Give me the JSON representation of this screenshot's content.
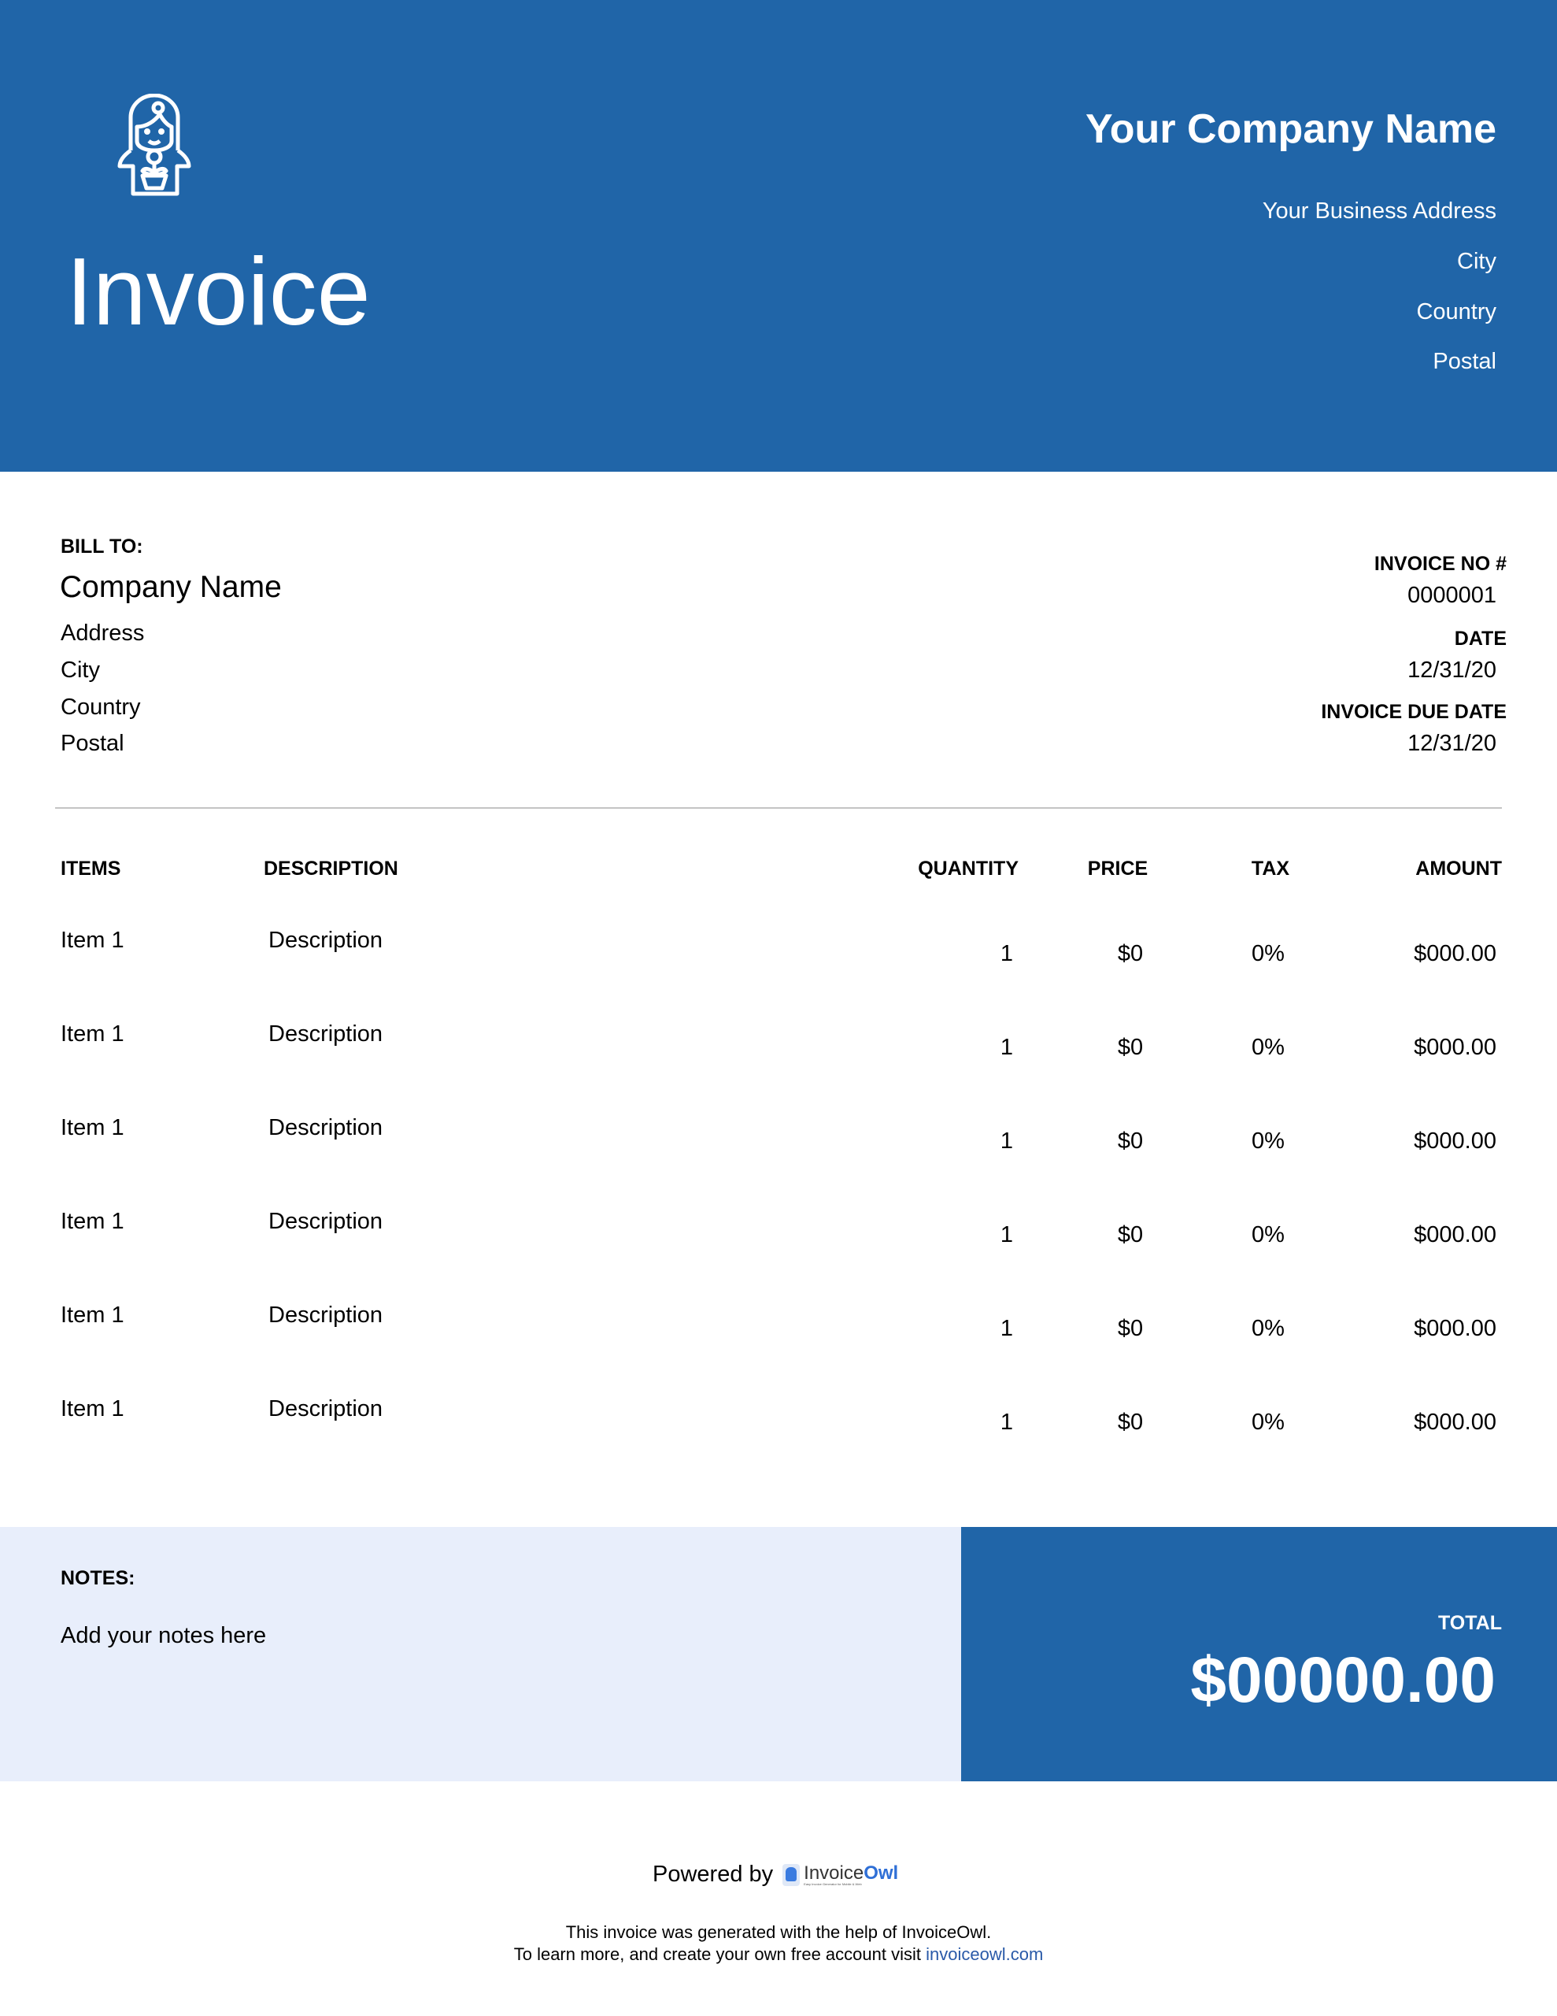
{
  "header": {
    "title": "Invoice",
    "company_name": "Your Company Name",
    "address_lines": [
      "Your Business Address",
      "City",
      "Country",
      "Postal"
    ],
    "logo_icon": "girl-with-flower-icon",
    "brand_color": "#2065a8"
  },
  "bill_to": {
    "label": "BILL TO:",
    "company": "Company Name",
    "lines": [
      "Address",
      "City",
      "Country",
      "Postal"
    ]
  },
  "meta": {
    "invoice_no_label": "INVOICE NO #",
    "invoice_no": "0000001",
    "date_label": "DATE",
    "date": "12/31/20",
    "due_label": "INVOICE DUE DATE",
    "due_date": "12/31/20"
  },
  "table": {
    "headers": [
      "ITEMS",
      "DESCRIPTION",
      "QUANTITY",
      "PRICE",
      "TAX",
      "AMOUNT"
    ],
    "rows": [
      {
        "item": "Item 1",
        "description": "Description",
        "quantity": "1",
        "price": "$0",
        "tax": "0%",
        "amount": "$000.00"
      },
      {
        "item": "Item 1",
        "description": "Description",
        "quantity": "1",
        "price": "$0",
        "tax": "0%",
        "amount": "$000.00"
      },
      {
        "item": "Item 1",
        "description": "Description",
        "quantity": "1",
        "price": "$0",
        "tax": "0%",
        "amount": "$000.00"
      },
      {
        "item": "Item 1",
        "description": "Description",
        "quantity": "1",
        "price": "$0",
        "tax": "0%",
        "amount": "$000.00"
      },
      {
        "item": "Item 1",
        "description": "Description",
        "quantity": "1",
        "price": "$0",
        "tax": "0%",
        "amount": "$000.00"
      },
      {
        "item": "Item 1",
        "description": "Description",
        "quantity": "1",
        "price": "$0",
        "tax": "0%",
        "amount": "$000.00"
      }
    ]
  },
  "notes": {
    "label": "NOTES:",
    "text": "Add your notes here"
  },
  "total": {
    "label": "TOTAL",
    "value": "$00000.00"
  },
  "footer": {
    "powered_by": "Powered by",
    "brand_invoice": "Invoice",
    "brand_owl": "Owl",
    "brand_tagline": "Easy Invoice Generator for Mobile & Web",
    "line1": "This invoice was generated with the help of InvoiceOwl.",
    "line2": "To learn more, and create your own free account visit",
    "link": "invoiceowl.com"
  }
}
